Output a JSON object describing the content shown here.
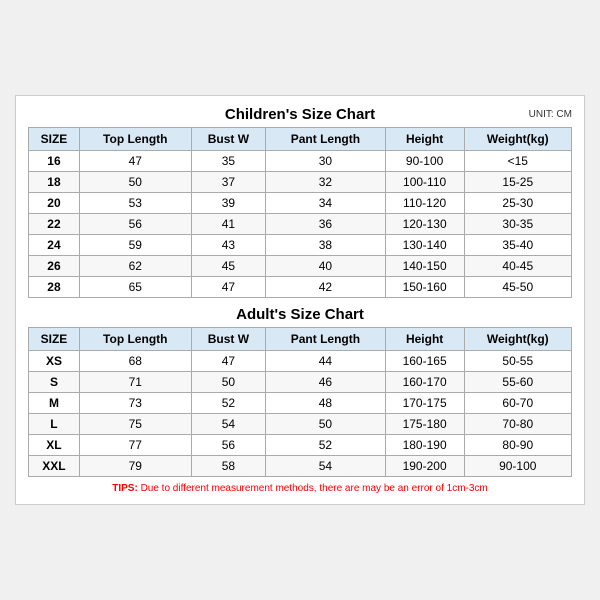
{
  "children": {
    "title": "Children's Size Chart",
    "unit": "UNIT: CM",
    "headers": [
      "SIZE",
      "Top Length",
      "Bust W",
      "Pant Length",
      "Height",
      "Weight(kg)"
    ],
    "rows": [
      [
        "16",
        "47",
        "35",
        "30",
        "90-100",
        "<15"
      ],
      [
        "18",
        "50",
        "37",
        "32",
        "100-110",
        "15-25"
      ],
      [
        "20",
        "53",
        "39",
        "34",
        "110-120",
        "25-30"
      ],
      [
        "22",
        "56",
        "41",
        "36",
        "120-130",
        "30-35"
      ],
      [
        "24",
        "59",
        "43",
        "38",
        "130-140",
        "35-40"
      ],
      [
        "26",
        "62",
        "45",
        "40",
        "140-150",
        "40-45"
      ],
      [
        "28",
        "65",
        "47",
        "42",
        "150-160",
        "45-50"
      ]
    ]
  },
  "adults": {
    "title": "Adult's Size Chart",
    "headers": [
      "SIZE",
      "Top Length",
      "Bust W",
      "Pant Length",
      "Height",
      "Weight(kg)"
    ],
    "rows": [
      [
        "XS",
        "68",
        "47",
        "44",
        "160-165",
        "50-55"
      ],
      [
        "S",
        "71",
        "50",
        "46",
        "160-170",
        "55-60"
      ],
      [
        "M",
        "73",
        "52",
        "48",
        "170-175",
        "60-70"
      ],
      [
        "L",
        "75",
        "54",
        "50",
        "175-180",
        "70-80"
      ],
      [
        "XL",
        "77",
        "56",
        "52",
        "180-190",
        "80-90"
      ],
      [
        "XXL",
        "79",
        "58",
        "54",
        "190-200",
        "90-100"
      ]
    ]
  },
  "tips": {
    "label": "TIPS:",
    "text": " Due to different measurement methods, there are may be an error of 1cm-3cm"
  }
}
